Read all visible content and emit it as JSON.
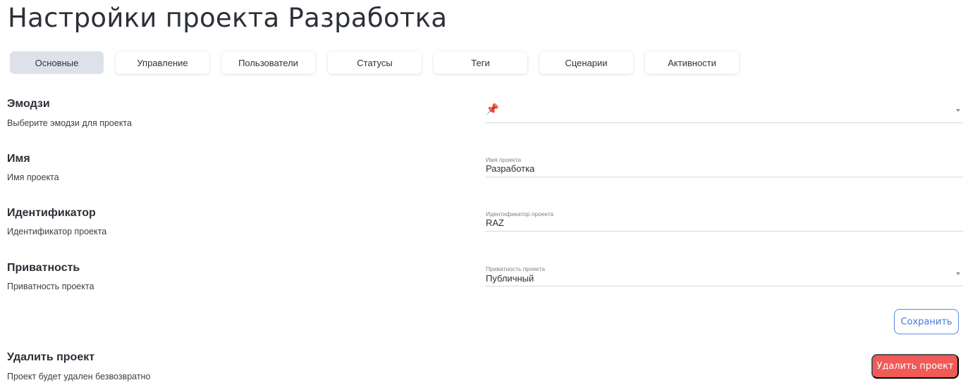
{
  "page": {
    "title": "Настройки проекта Разработка"
  },
  "tabs": [
    {
      "label": "Основные",
      "active": true
    },
    {
      "label": "Управление",
      "active": false
    },
    {
      "label": "Пользователи",
      "active": false
    },
    {
      "label": "Статусы",
      "active": false
    },
    {
      "label": "Теги",
      "active": false
    },
    {
      "label": "Сценарии",
      "active": false
    },
    {
      "label": "Активности",
      "active": false
    }
  ],
  "settings": {
    "emoji": {
      "title": "Эмодзи",
      "description": "Выберите эмодзи для проекта",
      "value": "📌",
      "icon": "pushpin-icon"
    },
    "name": {
      "title": "Имя",
      "description": "Имя проекта",
      "field_label": "Имя проекта",
      "value": "Разработка"
    },
    "identifier": {
      "title": "Идентификатор",
      "description": "Идентификатор проекта",
      "field_label": "Идентификатор проекта",
      "value": "RAZ"
    },
    "privacy": {
      "title": "Приватность",
      "description": "Приватность проекта",
      "field_label": "Приватность проекта",
      "value": "Публичный"
    }
  },
  "actions": {
    "save_label": "Сохранить",
    "delete": {
      "title": "Удалить проект",
      "description": "Проект будет удален безвозвратно",
      "button_label": "Удалить проект"
    }
  },
  "colors": {
    "accent": "#4a77d8",
    "danger": "#f05a57",
    "active_tab": "#dce1ea"
  }
}
